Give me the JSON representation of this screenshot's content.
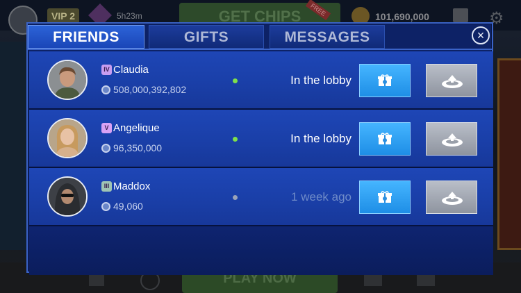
{
  "background": {
    "vip_label": "VIP 2",
    "timer": "5h23m",
    "banner_text": "GET CHIPS",
    "banner_badge": "FREE",
    "chip_balance": "101,690,000",
    "play_button": "PLAY NOW"
  },
  "tabs": [
    {
      "label": "FRIENDS",
      "active": true
    },
    {
      "label": "GIFTS",
      "active": false
    },
    {
      "label": "MESSAGES",
      "active": false
    }
  ],
  "close_label": "×",
  "friends": [
    {
      "name": "Claudia",
      "vip_level": "IV",
      "vip_color": "#c89df0",
      "chips": "508,000,392,802",
      "online": true,
      "status": "In the lobby"
    },
    {
      "name": "Angelique",
      "vip_level": "V",
      "vip_color": "#d9a2f5",
      "chips": "96,350,000",
      "online": true,
      "status": "In the lobby"
    },
    {
      "name": "Maddox",
      "vip_level": "III",
      "vip_color": "#9fc4b4",
      "chips": "49,060",
      "online": false,
      "status": "1 week ago"
    }
  ],
  "colors": {
    "online": "#7fe04a",
    "offline": "#9aa3b8",
    "accent": "#2c63d8"
  },
  "icons": {
    "gift": "gift-icon",
    "request_chips": "chip-request-icon",
    "chip": "chip-icon"
  }
}
